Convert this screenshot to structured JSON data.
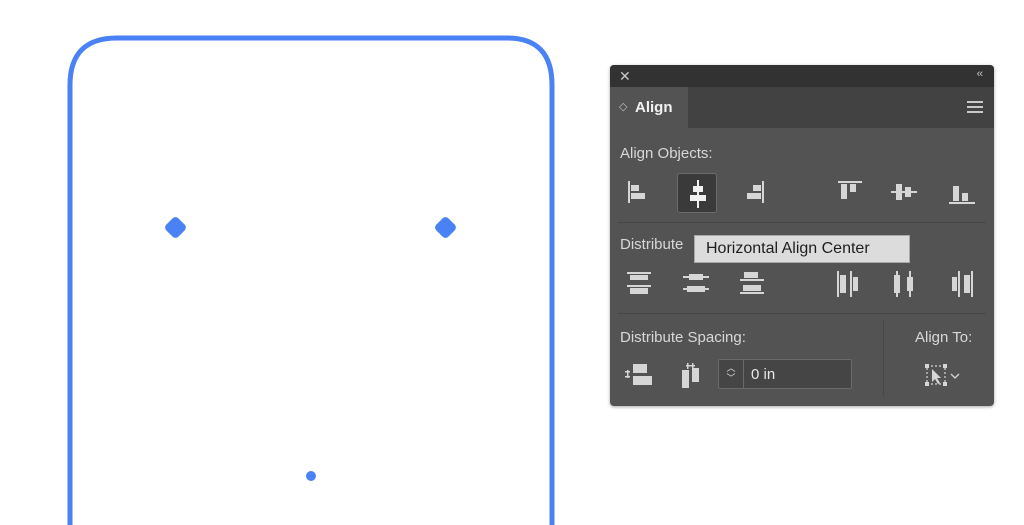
{
  "panel": {
    "tab_label": "Align",
    "align_objects_label": "Align Objects:",
    "distribute_objects_label": "Distribute",
    "distribute_spacing_label": "Distribute Spacing:",
    "align_to_label": "Align To:",
    "spacing_value": "0 in"
  },
  "tooltip": {
    "text": "Horizontal Align Center"
  },
  "colors": {
    "selection_blue": "#4a82f5",
    "panel_bg": "#535353",
    "titlebar": "#323232"
  }
}
